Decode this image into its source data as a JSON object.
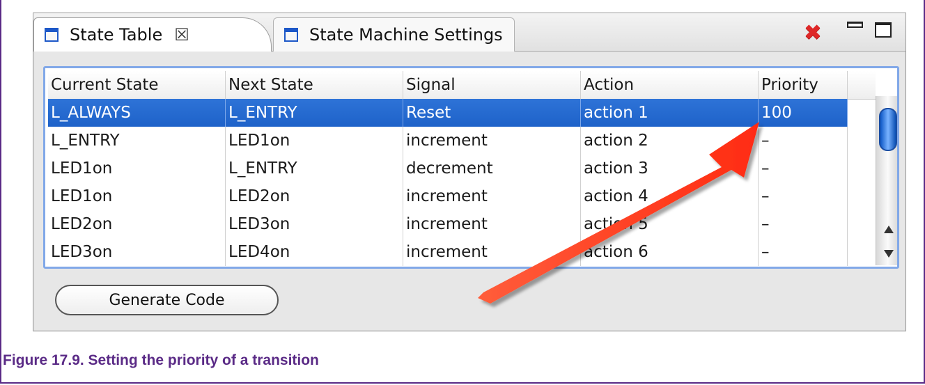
{
  "ui": {
    "tabs": [
      {
        "label": "State Table",
        "close_symbol": "☒"
      },
      {
        "label": "State Machine Settings"
      }
    ],
    "window_controls": {
      "close_symbol": "✖"
    },
    "table": {
      "columns": [
        "Current State",
        "Next State",
        "Signal",
        "Action",
        "Priority"
      ],
      "rows": [
        [
          "L_ALWAYS",
          "L_ENTRY",
          "Reset",
          "action 1",
          "100"
        ],
        [
          "L_ENTRY",
          "LED1on",
          "increment",
          "action 2",
          "–"
        ],
        [
          "LED1on",
          "L_ENTRY",
          "decrement",
          "action 3",
          "–"
        ],
        [
          "LED1on",
          "LED2on",
          "increment",
          "action 4",
          "–"
        ],
        [
          "LED2on",
          "LED3on",
          "increment",
          "action 5",
          "–"
        ],
        [
          "LED3on",
          "LED4on",
          "increment",
          "action 6",
          "–"
        ]
      ]
    },
    "generate_button": {
      "label": "Generate Code"
    },
    "colors": {
      "selection": "#2e73d7",
      "caption": "#5a2a86",
      "callout_arrow": "#ff3a1f"
    }
  },
  "caption": "Figure 17.9. Setting the priority of a transition"
}
